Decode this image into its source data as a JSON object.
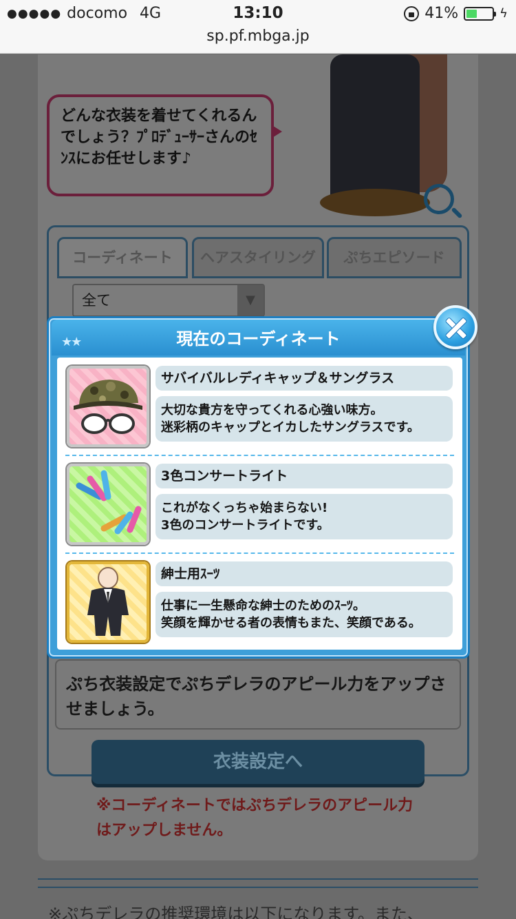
{
  "status": {
    "carrier": "docomo",
    "network": "4G",
    "time": "13:10",
    "battery_percent": "41%",
    "battery_level": 0.41
  },
  "url": "sp.pf.mbga.jp",
  "background": {
    "speech": "どんな衣装を着せてくれるんでしょう？ﾌﾟﾛﾃﾞｭｰｻｰさんのｾﾝｽにお任せします♪",
    "tabs": [
      "コーディネート",
      "ヘアスタイリング",
      "ぷちエピソード"
    ],
    "filter_value": "全て",
    "appeal_text": "ぷち衣装設定でぷちデレラのアピール力をアップさせましょう。",
    "costume_button": "衣装設定へ",
    "notice": "※コーディネートではぷちデレラのアピール力はアップしません。",
    "footer": "※ぷちデレラの推奨環境は以下になります。また、"
  },
  "modal": {
    "title": "現在のコーディネート",
    "items": [
      {
        "name": "サバイバルレディキャップ＆サングラス",
        "desc1": "大切な貴方を守ってくれる心強い味方。",
        "desc2": "迷彩柄のキャップとイカしたサングラスです。"
      },
      {
        "name": "3色コンサートライト",
        "desc1": "これがなくっちゃ始まらない!",
        "desc2": "3色のコンサートライトです。"
      },
      {
        "name": "紳士用ｽｰﾂ",
        "desc1": "仕事に一生懸命な紳士のためのｽｰﾂ。",
        "desc2": "笑顔を輝かせる者の表情もまた、笑顔である。"
      }
    ]
  },
  "colors": {
    "modal_blue": "#3e9fd9",
    "box_fill": "#d6e4ea",
    "separator": "#55b7ea"
  }
}
